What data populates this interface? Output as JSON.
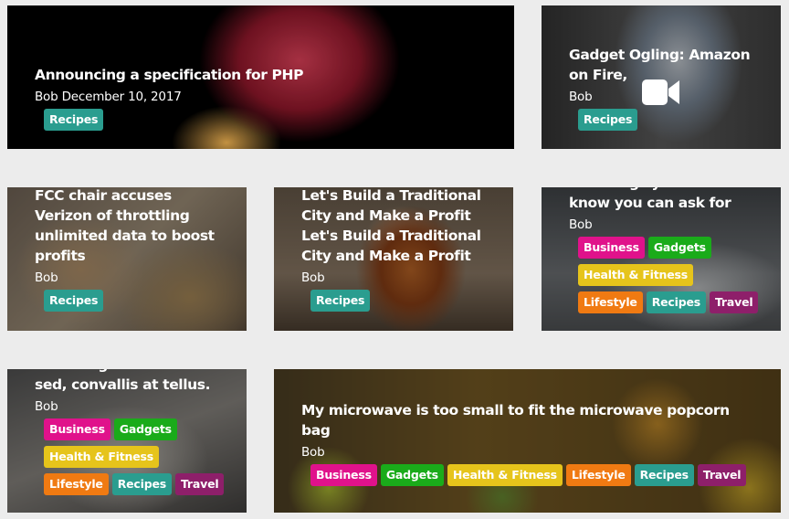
{
  "tag_colors": {
    "Recipes": "#2a9d8f",
    "Business": "#e0128b",
    "Gadgets": "#1aab1a",
    "Health & Fitness": "#e6c41b",
    "Lifestyle": "#f07a12",
    "Travel": "#8e1f6a"
  },
  "cards": [
    {
      "title": "Announcing a specification for PHP",
      "meta": "Bob December 10, 2017",
      "tags": [
        "Recipes"
      ]
    },
    {
      "title": "Gadget Ogling: Amazon on Fire,",
      "meta": "Bob",
      "tags": [
        "Recipes"
      ],
      "icon": "video-camera-icon"
    },
    {
      "title": "FCC chair accuses Verizon of throttling unlimited data to boost profits",
      "meta": "Bob",
      "tags": [
        "Recipes"
      ]
    },
    {
      "title": "Let's Build a Traditional City and Make a Profit Let's Build a Traditional City and Make a Profit",
      "meta": "Bob",
      "tags": [
        "Recipes"
      ]
    },
    {
      "title": "the things you didn't know you can ask for",
      "meta": "Bob",
      "tags": [
        "Business",
        "Gadgets",
        "Health & Fitness",
        "Lifestyle",
        "Recipes",
        "Travel"
      ]
    },
    {
      "title": "lacinia eget consectetur sed, convallis at tellus.",
      "meta": "Bob",
      "tags": [
        "Business",
        "Gadgets",
        "Health & Fitness",
        "Lifestyle",
        "Recipes",
        "Travel"
      ]
    },
    {
      "title": "My microwave is too small to fit the microwave popcorn bag",
      "meta": "Bob",
      "tags": [
        "Business",
        "Gadgets",
        "Health & Fitness",
        "Lifestyle",
        "Recipes",
        "Travel"
      ]
    }
  ]
}
